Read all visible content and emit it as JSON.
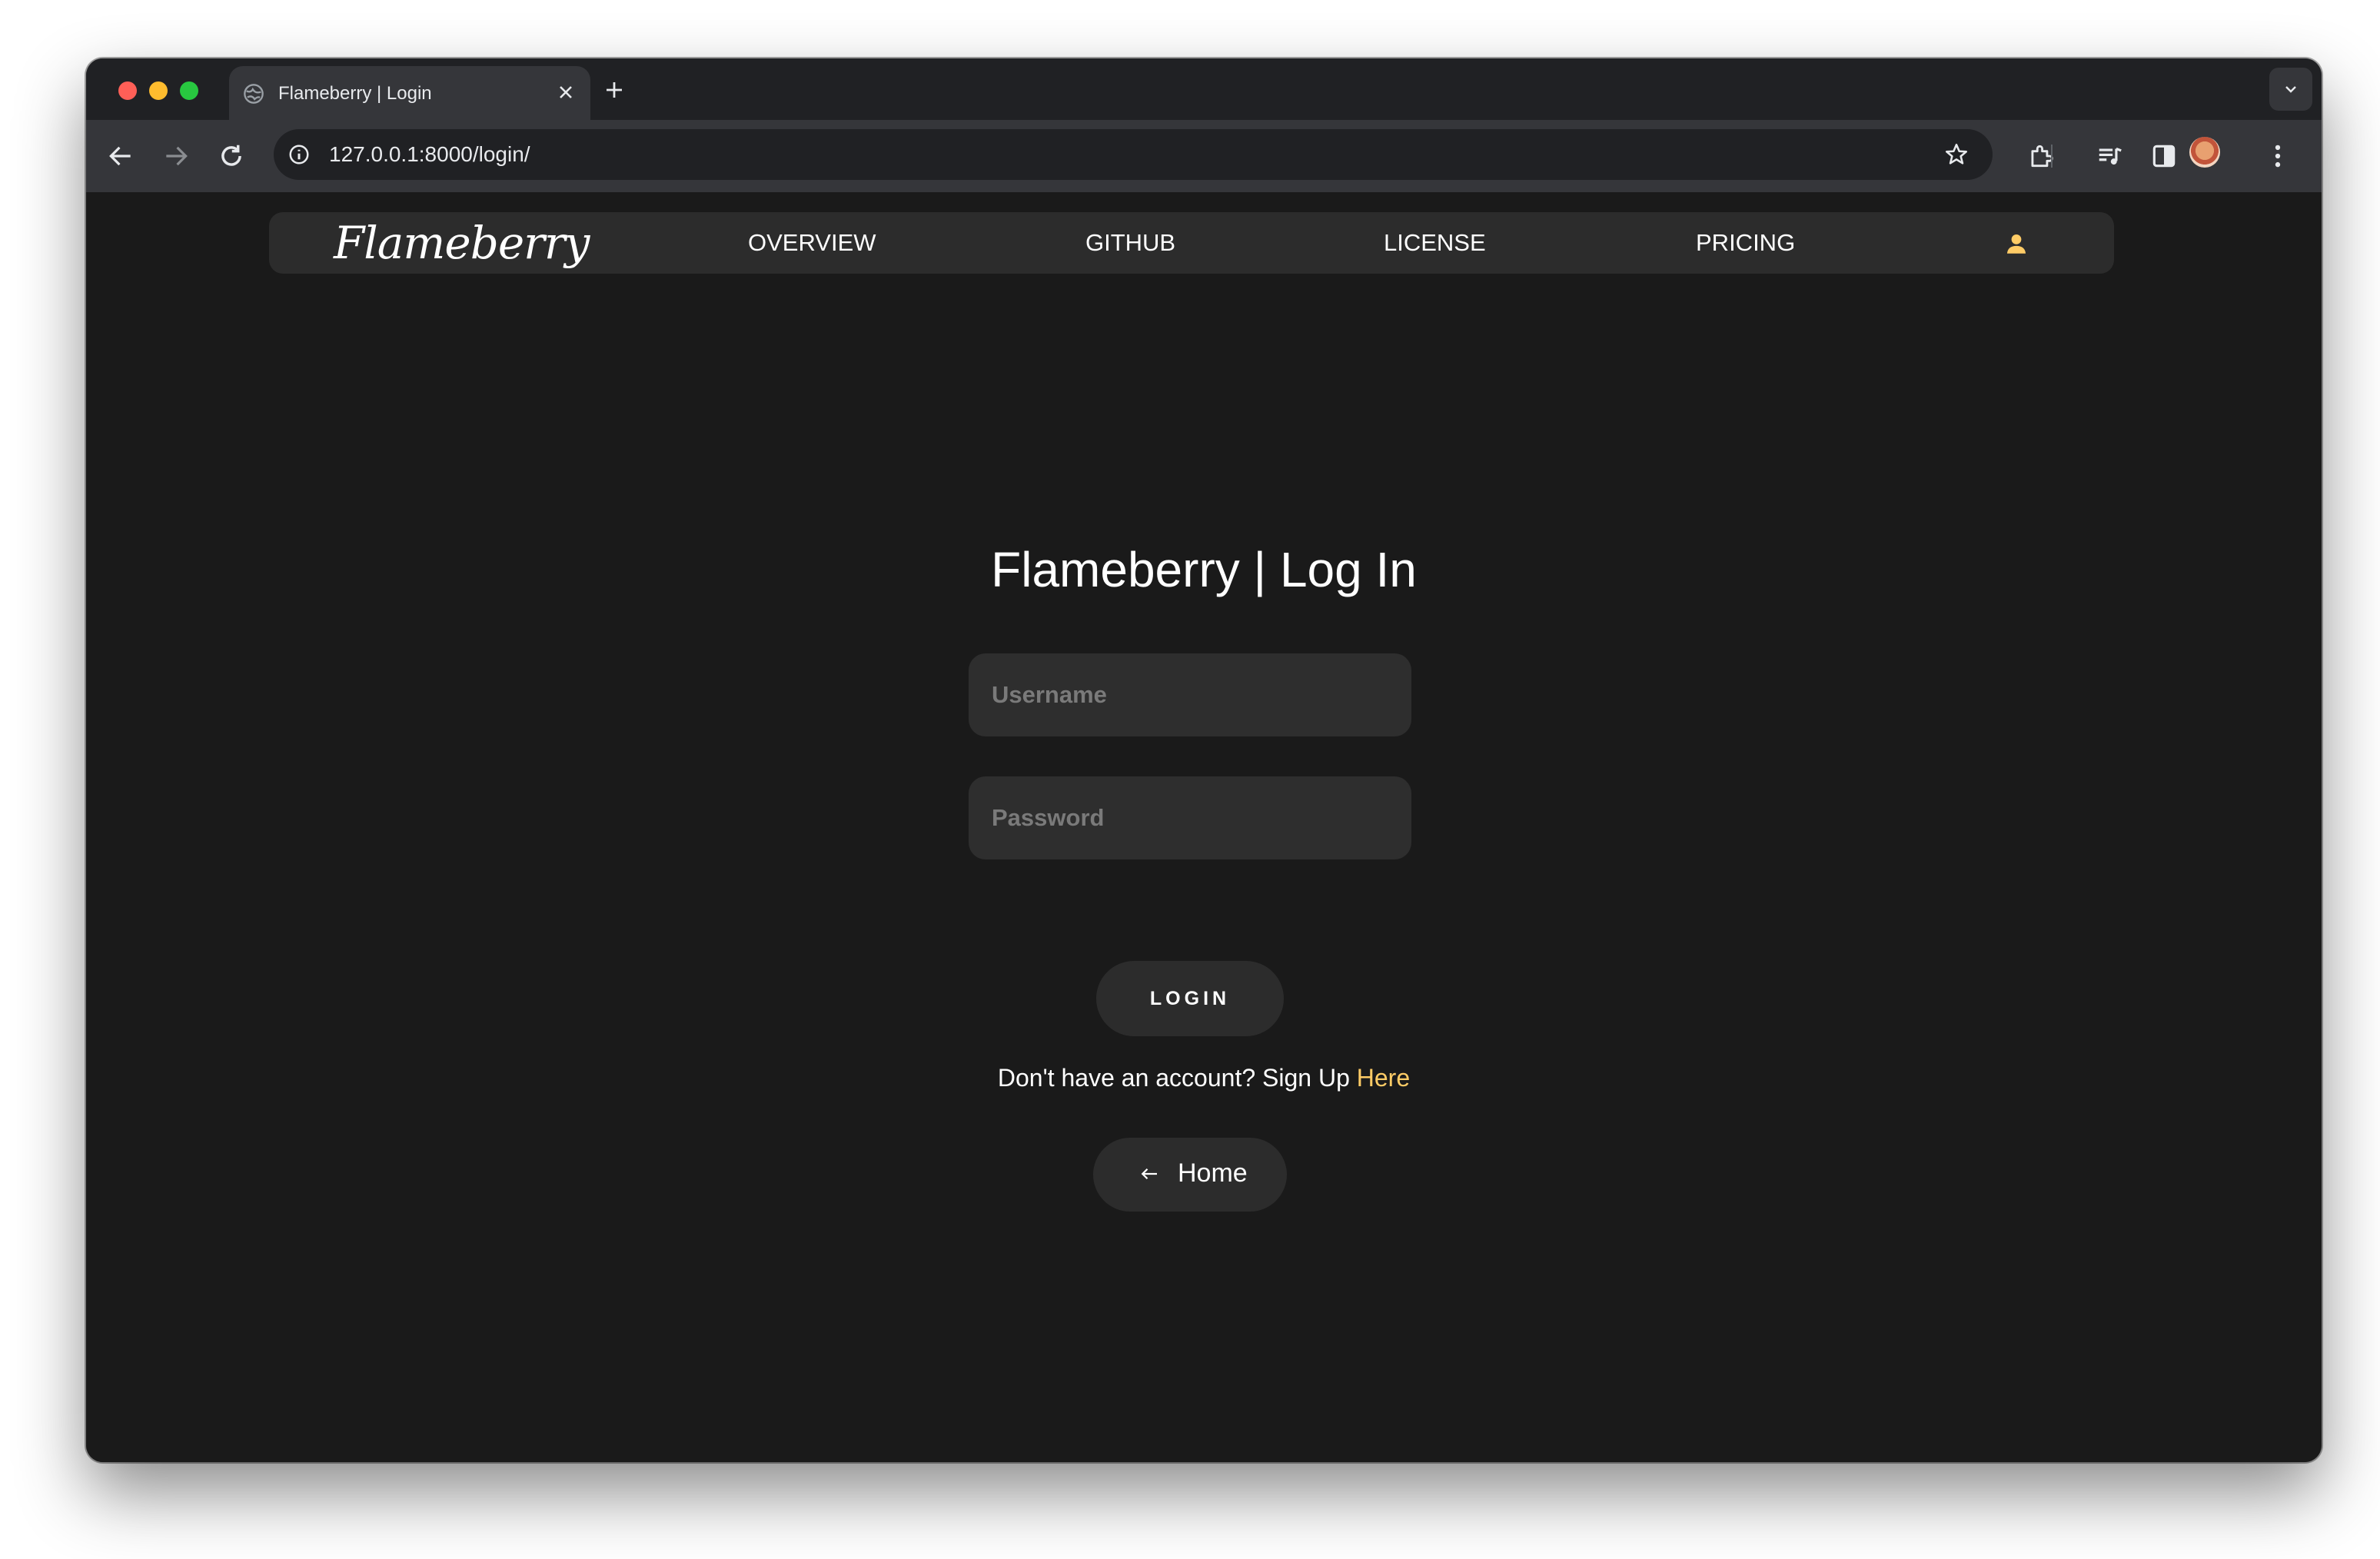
{
  "browser": {
    "tab": {
      "title": "Flameberry | Login"
    },
    "address_bar": {
      "url": "127.0.0.1:8000/login/"
    }
  },
  "navbar": {
    "logo": "Flameberry",
    "links": [
      {
        "label": "OVERVIEW"
      },
      {
        "label": "GITHUB"
      },
      {
        "label": "LICENSE"
      },
      {
        "label": "PRICING"
      }
    ],
    "user_icon": "user-icon"
  },
  "login": {
    "title": "Flameberry | Log In",
    "username_placeholder": "Username",
    "password_placeholder": "Password",
    "submit_label": "LOGIN",
    "signup_prompt": "Don't have an account? Sign Up",
    "signup_link": "Here",
    "home_label": "Home"
  },
  "colors": {
    "page_background": "#1a1a1a",
    "surface": "#2c2c2c",
    "accent": "#ffcc66",
    "text": "#ffffff"
  }
}
